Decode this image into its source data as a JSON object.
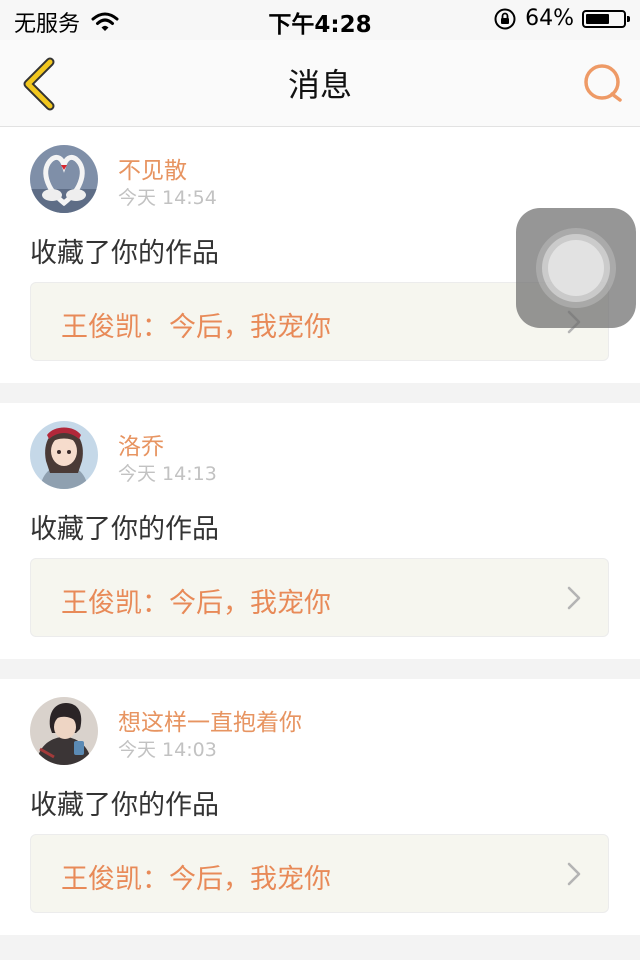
{
  "status_bar": {
    "carrier": "无服务",
    "time": "下午4:28",
    "battery_percent": "64%",
    "battery_level": 0.64,
    "icons": [
      "wifi-icon",
      "orientation-lock-icon",
      "battery-icon"
    ]
  },
  "nav": {
    "title": "消息",
    "back_icon": "chevron-left-icon",
    "search_icon": "search-icon"
  },
  "colors": {
    "accent_orange": "#e79461",
    "back_yellow": "#f2c71e",
    "work_box_bg": "#f6f6ef"
  },
  "messages": [
    {
      "user": "不见散",
      "time": "今天 14:54",
      "action": "收藏了你的作品",
      "work": "王俊凯：今后，我宠你",
      "avatar": "swan-heart-avatar"
    },
    {
      "user": "洛乔",
      "time": "今天 14:13",
      "action": "收藏了你的作品",
      "work": "王俊凯：今后，我宠你",
      "avatar": "anime-girl-avatar"
    },
    {
      "user": "想这样一直抱着你",
      "time": "今天 14:03",
      "action": "收藏了你的作品",
      "work": "王俊凯：今后，我宠你",
      "avatar": "anime-boy-avatar"
    }
  ]
}
